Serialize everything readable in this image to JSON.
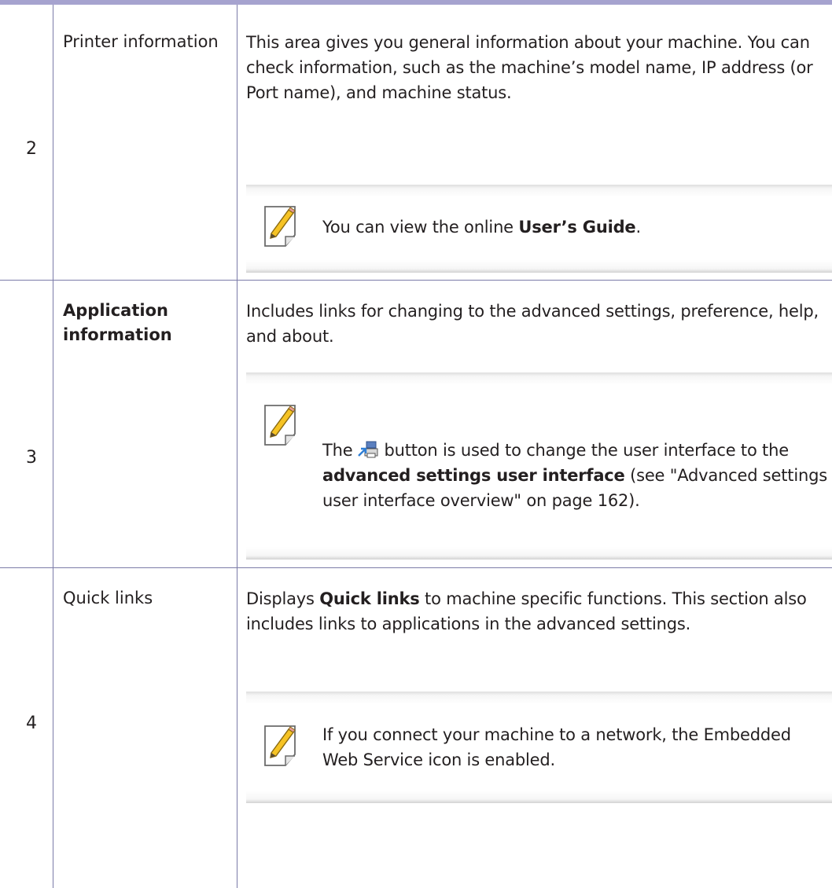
{
  "rows": [
    {
      "number": "2",
      "label": "Printer information",
      "description": "This area gives you general information about your machine. You can check information, such as the machine’s model name, IP address (or Port name), and machine status.",
      "note": {
        "icon": "note-pencil-icon",
        "prefix": "You can view the online ",
        "bold": "User’s Guide",
        "suffix": "."
      }
    },
    {
      "number": "3",
      "label": "Application information",
      "description": "Includes links for changing to the advanced settings, preference, help, and about.",
      "note": {
        "icon": "note-pencil-icon",
        "prefix": "The",
        "button_icon": "advanced-settings-switch-icon",
        "middle": "button is used to change the user interface to the ",
        "bold": "advanced settings user interface",
        "suffix": " (see \"Advanced settings user interface overview\" on page 162)."
      }
    },
    {
      "number": "4",
      "label": "Quick links",
      "description_prefix": "Displays ",
      "description_bold": "Quick links",
      "description_suffix": " to machine specific functions. This section also includes links to applications in the advanced settings.",
      "note": {
        "icon": "note-pencil-icon",
        "text": "If you connect your machine to a network, the Embedded Web Service icon is enabled."
      }
    }
  ],
  "colors": {
    "rule": "#a6a3cf",
    "grid": "#7b7ba8",
    "text": "#231f20"
  }
}
